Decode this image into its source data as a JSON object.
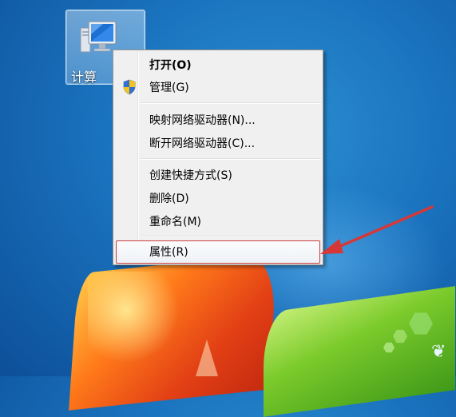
{
  "desktop": {
    "icon_label": "计算",
    "icon_name": "computer-icon"
  },
  "context_menu": {
    "items": [
      {
        "label": "打开(O)",
        "bold": true
      },
      {
        "label": "管理(G)",
        "icon": "uac-shield-icon"
      },
      {
        "label": "映射网络驱动器(N)..."
      },
      {
        "label": "断开网络驱动器(C)..."
      },
      {
        "label": "创建快捷方式(S)"
      },
      {
        "label": "删除(D)"
      },
      {
        "label": "重命名(M)"
      },
      {
        "label": "属性(R)",
        "highlighted": true
      }
    ]
  },
  "colors": {
    "highlight_border": "#c93a3a",
    "arrow": "#d63838",
    "menu_background": "#f0f0f0"
  }
}
